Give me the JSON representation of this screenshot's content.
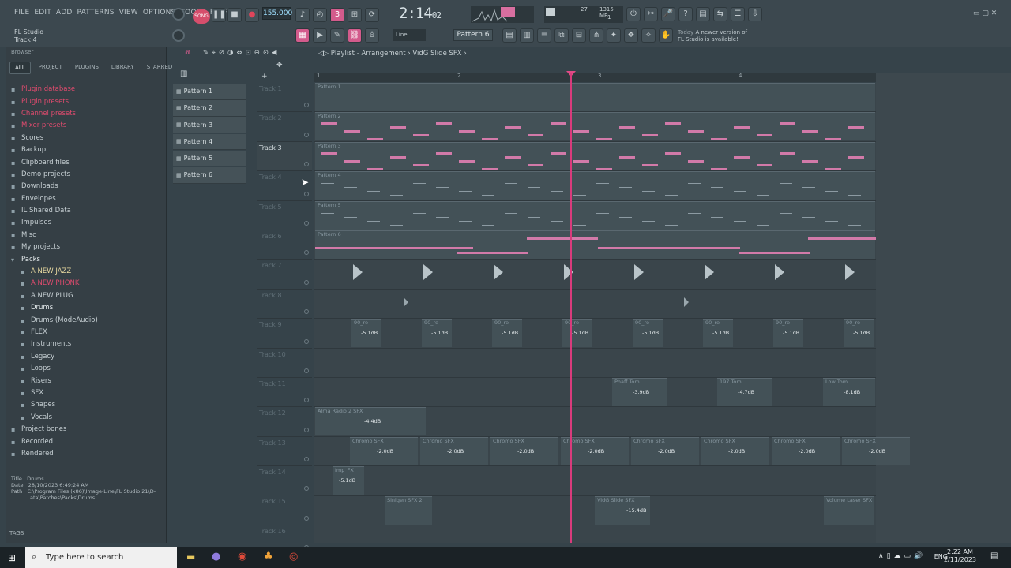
{
  "menu": [
    "FILE",
    "EDIT",
    "ADD",
    "PATTERNS",
    "VIEW",
    "OPTIONS",
    "TOOLS",
    "HELP"
  ],
  "app": {
    "name": "FL Studio",
    "hint_channel": "Track 4"
  },
  "transport": {
    "mode": "SONG",
    "tempo": "155.000",
    "time_main": "2:14",
    "time_small": "02",
    "memory": "1315 MB",
    "cpu_val": "27",
    "cpu_sub": "1"
  },
  "snap": "Line",
  "pattern_selector": "Pattern 6",
  "news": {
    "day": "Today",
    "line1": "A newer version of",
    "line2": "FL Studio is available!"
  },
  "browser": {
    "title": "Browser",
    "tabs": [
      "ALL",
      "PROJECT",
      "PLUGINS",
      "LIBRARY",
      "STARRED"
    ],
    "items": [
      {
        "label": "Plugin database",
        "cls": "red"
      },
      {
        "label": "Plugin presets",
        "cls": "red"
      },
      {
        "label": "Channel presets",
        "cls": "red"
      },
      {
        "label": "Mixer presets",
        "cls": "red"
      },
      {
        "label": "Scores",
        "cls": ""
      },
      {
        "label": "Backup",
        "cls": ""
      },
      {
        "label": "Clipboard files",
        "cls": ""
      },
      {
        "label": "Demo projects",
        "cls": ""
      },
      {
        "label": "Downloads",
        "cls": ""
      },
      {
        "label": "Envelopes",
        "cls": ""
      },
      {
        "label": "IL Shared Data",
        "cls": ""
      },
      {
        "label": "Impulses",
        "cls": ""
      },
      {
        "label": "Misc",
        "cls": ""
      },
      {
        "label": "My projects",
        "cls": ""
      },
      {
        "label": "Packs",
        "cls": "bold"
      },
      {
        "label": "A NEW JAZZ",
        "cls": "sub yel"
      },
      {
        "label": "A NEW PHONK",
        "cls": "sub red"
      },
      {
        "label": "A NEW PLUG",
        "cls": "sub"
      },
      {
        "label": "Drums",
        "cls": "sub bold"
      },
      {
        "label": "Drums (ModeAudio)",
        "cls": "sub"
      },
      {
        "label": "FLEX",
        "cls": "sub"
      },
      {
        "label": "Instruments",
        "cls": "sub"
      },
      {
        "label": "Legacy",
        "cls": "sub"
      },
      {
        "label": "Loops",
        "cls": "sub"
      },
      {
        "label": "Risers",
        "cls": "sub"
      },
      {
        "label": "SFX",
        "cls": "sub"
      },
      {
        "label": "Shapes",
        "cls": "sub"
      },
      {
        "label": "Vocals",
        "cls": "sub"
      },
      {
        "label": "Project bones",
        "cls": ""
      },
      {
        "label": "Recorded",
        "cls": ""
      },
      {
        "label": "Rendered",
        "cls": ""
      }
    ],
    "info": {
      "title_label": "Title",
      "title": "Drums",
      "date_label": "Date",
      "date": "28/10/2023 6:49:24 AM",
      "path_label": "Path",
      "path1": "C:\\Program Files (x86)\\Image-Line\\FL Studio 21\\D-",
      "path2": "ata\\Patches\\Packs\\Drums"
    },
    "tags": "TAGS"
  },
  "patterns": [
    "Pattern 1",
    "Pattern 2",
    "Pattern 3",
    "Pattern 4",
    "Pattern 5",
    "Pattern 6"
  ],
  "playlist": {
    "title": "Playlist - Arrangement",
    "crumb": "VidG Slide SFX"
  },
  "ruler": [
    "1",
    "2",
    "3",
    "4",
    "5"
  ],
  "tracks": [
    "Track 1",
    "Track 2",
    "Track 3",
    "Track 4",
    "Track 5",
    "Track 6",
    "Track 7",
    "Track 8",
    "Track 9",
    "Track 10",
    "Track 11",
    "Track 12",
    "Track 13",
    "Track 14",
    "Track 15",
    "Track 16"
  ],
  "clip_names": {
    "p1": "Pattern 1",
    "p2": "Pattern 2",
    "p3": "Pattern 3",
    "p4": "Pattern 4",
    "p5": "Pattern 5",
    "p6": "Pattern 6",
    "t9": "90_re",
    "t11a": "Phaff Tom",
    "t11b": "197 Tom",
    "t11c": "Low Tom",
    "t12": "Alma Radio 2 SFX",
    "t13": "Chromo SFX",
    "t14": "Imp_FX",
    "t15a": "Sinigen SFX 2",
    "t15b": "VidG Slide SFX",
    "t15c": "Volume Laser SFX"
  },
  "db": {
    "t9": "-5.1dB",
    "t11a": "-3.9dB",
    "t11b": "-4.7dB",
    "t11c": "-8.1dB",
    "t12": "-4.4dB",
    "t13": "-2.0dB",
    "t14": "-5.1dB",
    "t15": "-15.4dB"
  },
  "taskbar": {
    "search": "Type here to search",
    "lang": "ENG",
    "time": "2:22 AM",
    "date": "2/11/2023"
  }
}
